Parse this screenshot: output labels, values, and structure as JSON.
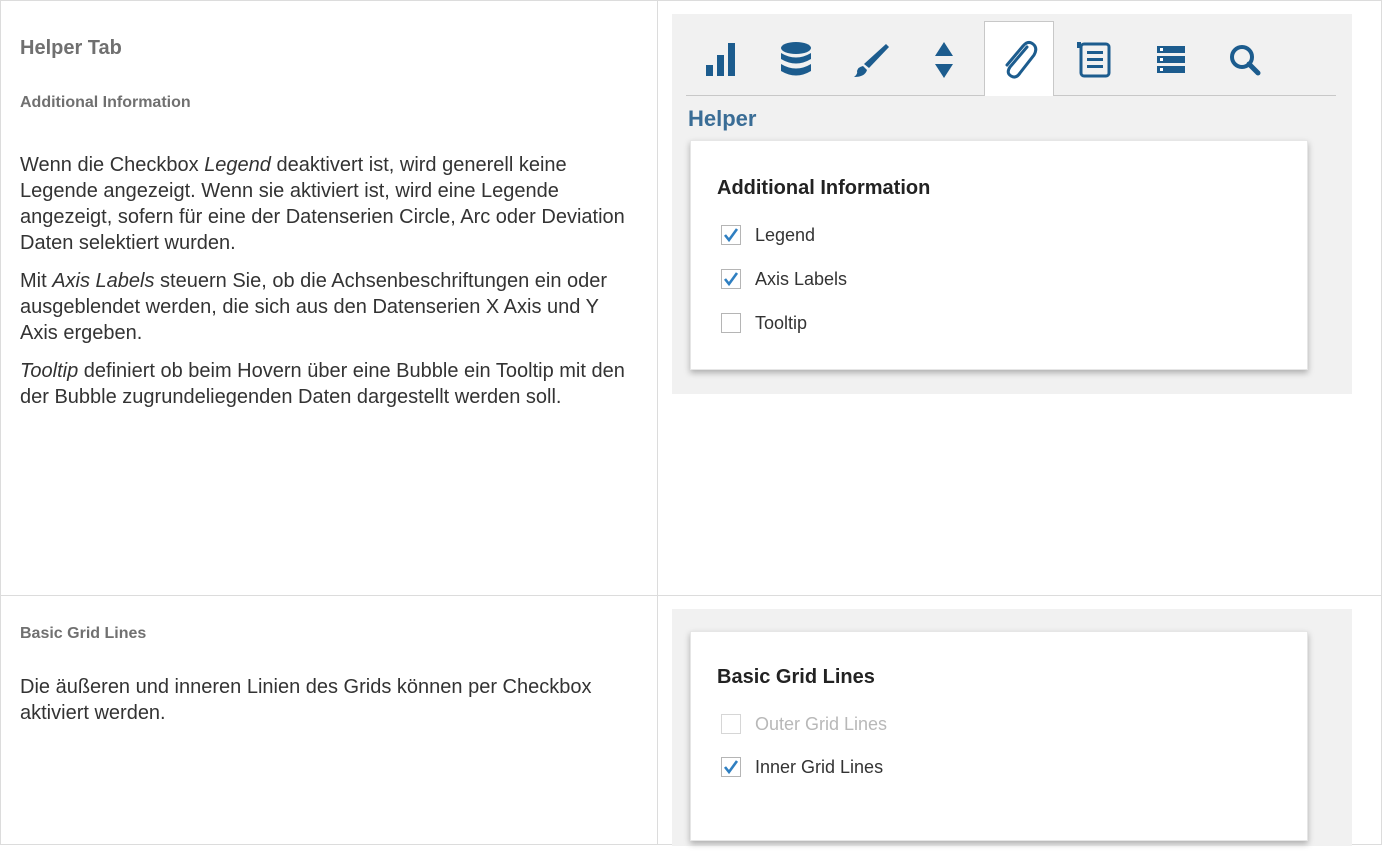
{
  "left_top": {
    "heading": "Helper Tab",
    "subheading": "Additional Information",
    "p1": {
      "a": "Wenn die Checkbox ",
      "em": "Legend",
      "b": " deaktivert ist, wird generell keine Legende angezeigt. Wenn sie aktiviert ist, wird eine Legende angezeigt, sofern für eine der Datenserien Circle, Arc oder Deviation Daten selektiert wurden."
    },
    "p2": {
      "a": "Mit ",
      "em": "Axis Labels",
      "b": " steuern Sie, ob die Achsenbeschriftungen ein oder ausgeblendet werden, die sich aus den Datenserien X Axis und Y Axis ergeben."
    },
    "p3": {
      "em": "Tooltip",
      "b": " definiert ob beim Hovern über eine Bubble ein Tooltip mit den der Bubble zugrundeliegenden Daten dargestellt werden soll."
    }
  },
  "left_bottom": {
    "subheading": "Basic Grid Lines",
    "p": "Die äußeren und inneren Linien des Grids können per Checkbox aktiviert werden."
  },
  "toolbar": {
    "icons": [
      "bar-chart-icon",
      "database-icon",
      "brush-icon",
      "sort-arrows-icon",
      "paperclip-icon",
      "list-icon",
      "rows-icon",
      "search-icon"
    ],
    "active_index": 4,
    "color": "#1c5c8e"
  },
  "helper_panel": {
    "label": "Helper",
    "card_title": "Additional Information",
    "options": [
      {
        "label": "Legend",
        "checked": true
      },
      {
        "label": "Axis Labels",
        "checked": true
      },
      {
        "label": "Tooltip",
        "checked": false
      }
    ]
  },
  "grid_panel": {
    "card_title": "Basic Grid Lines",
    "options": [
      {
        "label": "Outer Grid Lines",
        "checked": false,
        "disabled": true
      },
      {
        "label": "Inner Grid Lines",
        "checked": true
      }
    ]
  },
  "colors": {
    "icon": "#1c5c8e",
    "helper_label": "#3a6d96",
    "check": "#2f7fc1"
  }
}
